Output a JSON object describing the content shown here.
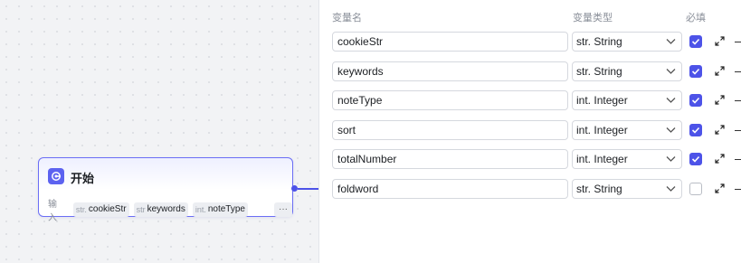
{
  "node": {
    "title": "开始",
    "inputs_label": "输入",
    "chips": [
      {
        "type": "str.",
        "name": "cookieStr"
      },
      {
        "type": "str",
        "name": "keywords"
      },
      {
        "type": "int.",
        "name": "noteType"
      }
    ],
    "more": "···"
  },
  "panel": {
    "headers": {
      "name": "变量名",
      "type": "变量类型",
      "required": "必填"
    },
    "rows": [
      {
        "name": "cookieStr",
        "type_prefix": "str.",
        "type_label": "String",
        "required": true
      },
      {
        "name": "keywords",
        "type_prefix": "str.",
        "type_label": "String",
        "required": true
      },
      {
        "name": "noteType",
        "type_prefix": "int.",
        "type_label": "Integer",
        "required": true
      },
      {
        "name": "sort",
        "type_prefix": "int.",
        "type_label": "Integer",
        "required": true
      },
      {
        "name": "totalNumber",
        "type_prefix": "int.",
        "type_label": "Integer",
        "required": true
      },
      {
        "name": "foldword",
        "type_prefix": "str.",
        "type_label": "String",
        "required": false
      }
    ]
  },
  "colors": {
    "accent": "#4d53e8",
    "node_border": "#6b6ef5"
  },
  "icons": {
    "node": "start-node-icon",
    "dropdown": "chevron-down-icon",
    "expand": "expand-icon",
    "check": "check-icon"
  }
}
